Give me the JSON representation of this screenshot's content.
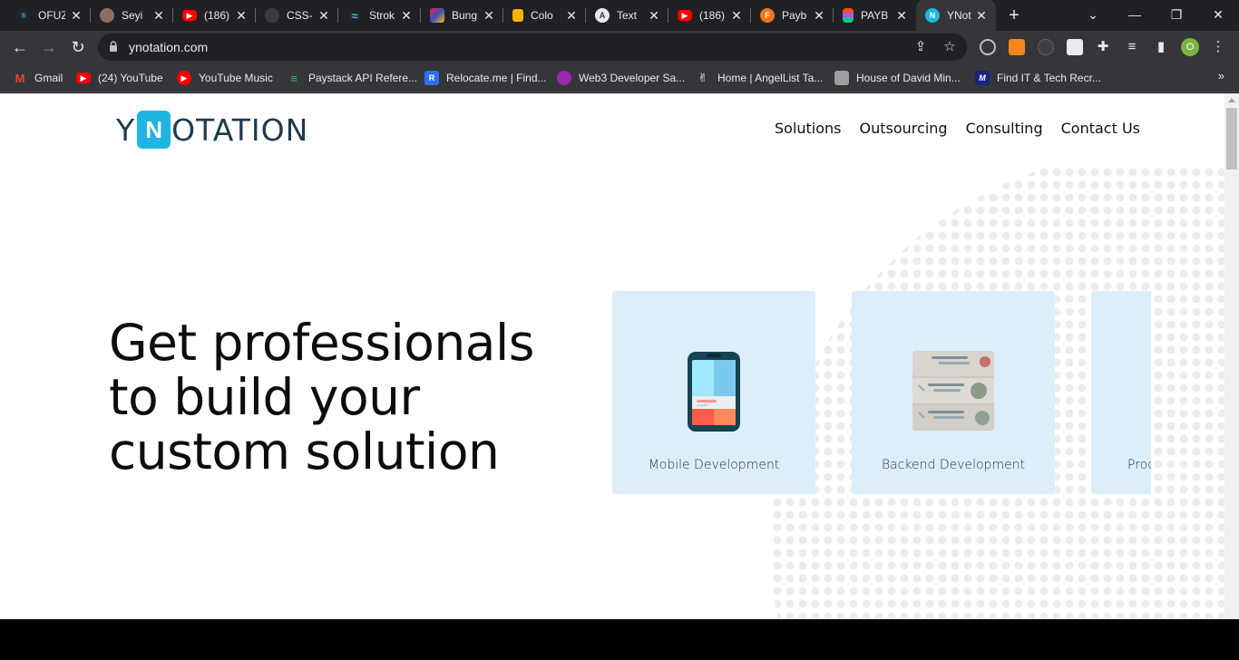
{
  "browser": {
    "tabs": [
      {
        "title": "OFUZ",
        "icon": "react-icon",
        "color": "#61dafb"
      },
      {
        "title": "Seyi",
        "icon": "avatar-icon",
        "color": "#8d6e63"
      },
      {
        "title": "(186)",
        "icon": "youtube-icon",
        "color": "#ff0000"
      },
      {
        "title": "CSS-",
        "icon": "github-icon",
        "color": "#24292f"
      },
      {
        "title": "Strok",
        "icon": "tailwind-icon",
        "color": "#38bdf8"
      },
      {
        "title": "Bung",
        "icon": "figma-like-icon",
        "color": "#e91e63"
      },
      {
        "title": "Colo",
        "icon": "color-icon",
        "color": "#f4b400"
      },
      {
        "title": "Text",
        "icon": "text-icon",
        "color": "#4caf50"
      },
      {
        "title": "(186)",
        "icon": "youtube-icon",
        "color": "#ff0000"
      },
      {
        "title": "Payb",
        "icon": "payb-icon",
        "color": "#f97316"
      },
      {
        "title": "PAYB",
        "icon": "figma-icon",
        "color": "#a259ff"
      },
      {
        "title": "YNot",
        "icon": "ynotation-icon",
        "color": "#20b5e0"
      }
    ],
    "new_tab": "+",
    "window_controls": {
      "minimize": "—",
      "restore": "❐",
      "close": "✕",
      "dropdown": "⌄"
    },
    "url": "ynotation.com",
    "bookmarks": [
      {
        "label": "Gmail",
        "icon": "gmail-icon",
        "color": "#ea4335"
      },
      {
        "label": "(24) YouTube",
        "icon": "youtube-icon",
        "color": "#ff0000"
      },
      {
        "label": "YouTube Music",
        "icon": "youtube-music-icon",
        "color": "#ff0000"
      },
      {
        "label": "Paystack API Refere...",
        "icon": "paystack-icon",
        "color": "#3bb75e"
      },
      {
        "label": "Relocate.me | Find...",
        "icon": "relocate-icon",
        "color": "#2f6fed"
      },
      {
        "label": "Web3 Developer Sa...",
        "icon": "web3-icon",
        "color": "#9c27b0"
      },
      {
        "label": "Home | AngelList Ta...",
        "icon": "angellist-icon",
        "color": "#ffffff"
      },
      {
        "label": "House of David Min...",
        "icon": "house-icon",
        "color": "#9e9e9e"
      },
      {
        "label": "Find IT & Tech Recr...",
        "icon": "m-icon",
        "color": "#1a237e"
      }
    ],
    "bookmarks_more": "»",
    "profile_initial": "O"
  },
  "site": {
    "logo": {
      "left": "Y",
      "box": "N",
      "right": "OTATION"
    },
    "nav": [
      "Solutions",
      "Outsourcing",
      "Consulting",
      "Contact Us"
    ],
    "hero_lines": [
      "Get professionals",
      "to build your",
      "custom solution"
    ],
    "cards": [
      {
        "label": "Mobile Development",
        "icon": "mobile-phone-icon"
      },
      {
        "label": "Backend Development",
        "icon": "server-rack-icon"
      },
      {
        "label": "Prod",
        "icon": "product-icon"
      }
    ],
    "colors": {
      "brand": "#20b5e0",
      "logo_text": "#1e3a4f",
      "card_bg": "#ddeefb",
      "footer": "#000000"
    }
  }
}
